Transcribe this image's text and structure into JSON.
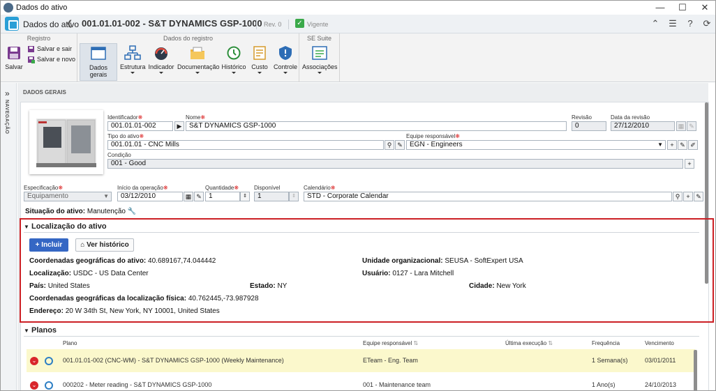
{
  "window": {
    "title": "Dados do ativo",
    "minimize": "—",
    "maximize": "☐",
    "close": "✕"
  },
  "header": {
    "module": "Dados do ativo",
    "record_title": "001.01.01-002 - S&T DYNAMICS GSP-1000",
    "revision": "Rev. 0",
    "status": "Vigente",
    "icons": [
      "collapse-icon",
      "list-icon",
      "help-icon",
      "refresh-icon"
    ]
  },
  "ribbon": {
    "groups": [
      "Registro",
      "Dados do registro",
      "SE Suite"
    ],
    "registro": {
      "save": "Salvar",
      "save_exit": "Salvar e sair",
      "save_new": "Salvar e novo"
    },
    "buttons": [
      "Dados gerais",
      "Estrutura",
      "Indicador",
      "Documentação",
      "Histórico",
      "Custo",
      "Controle",
      "Associações"
    ]
  },
  "nav": {
    "label": "NAVEGAÇÃO",
    "chevron": "»"
  },
  "section_title": "DADOS GERAIS",
  "form": {
    "identificador_label": "Identificador",
    "identificador": "001.01.01-002",
    "nome_label": "Nome",
    "nome": "S&T DYNAMICS GSP-1000",
    "revisao_label": "Revisão",
    "revisao": "0",
    "data_revisao_label": "Data da revisão",
    "data_revisao": "27/12/2010",
    "tipo_label": "Tipo do ativo",
    "tipo": "001.01.01 - CNC Mills",
    "equipe_label": "Equipe responsável",
    "equipe": "EGN - Engineers",
    "condicao_label": "Condição",
    "condicao": "001 - Good",
    "especificacao_label": "Especificação",
    "especificacao": "Equipamento",
    "inicio_label": "Início da operação",
    "inicio": "03/12/2010",
    "quantidade_label": "Quantidade",
    "quantidade": "1",
    "disponivel_label": "Disponível",
    "disponivel": "1",
    "calendario_label": "Calendário",
    "calendario": "STD - Corporate Calendar",
    "situacao_label": "Situação do ativo:",
    "situacao": "Manutenção"
  },
  "localizacao": {
    "title": "Localização do ativo",
    "incluir": "Incluir",
    "ver_historico": "Ver histórico",
    "coord_label": "Coordenadas geográficas do ativo:",
    "coord": "40.689167,74.044442",
    "unidade_label": "Unidade organizacional:",
    "unidade": "SEUSA - SoftExpert USA",
    "localizacao_label": "Localização:",
    "localizacao": "USDC - US Data Center",
    "usuario_label": "Usuário:",
    "usuario": "0127 - Lara Mitchell",
    "pais_label": "País:",
    "pais": "United States",
    "estado_label": "Estado:",
    "estado": "NY",
    "cidade_label": "Cidade:",
    "cidade": "New York",
    "coord_fisica_label": "Coordenadas geográficas da localização física:",
    "coord_fisica": "40.762445,-73.987928",
    "endereco_label": "Endereço:",
    "endereco": "20 W 34th St, New York, NY 10001, United States"
  },
  "planos": {
    "title": "Planos",
    "columns": [
      "Plano",
      "Equipe responsável",
      "Última execução",
      "Frequência",
      "Vencimento"
    ],
    "rows": [
      {
        "plano": "001.01.01-002 (CNC-WM) - S&T DYNAMICS GSP-1000 (Weekly Maintenance)",
        "equipe": "ETeam - Eng. Team",
        "ultima": "",
        "frequencia": "1 Semana(s)",
        "vencimento": "03/01/2011"
      },
      {
        "plano": "000202 - Meter reading - S&T DYNAMICS GSP-1000",
        "equipe": "001 - Maintenance team",
        "ultima": "",
        "frequencia": "1 Ano(s)",
        "vencimento": "24/10/2013"
      }
    ]
  },
  "colors": {
    "accent": "#3567c4",
    "highlight": "#cc1f24",
    "status_green": "#3aa94a",
    "row_selected": "#fbf8cc"
  }
}
